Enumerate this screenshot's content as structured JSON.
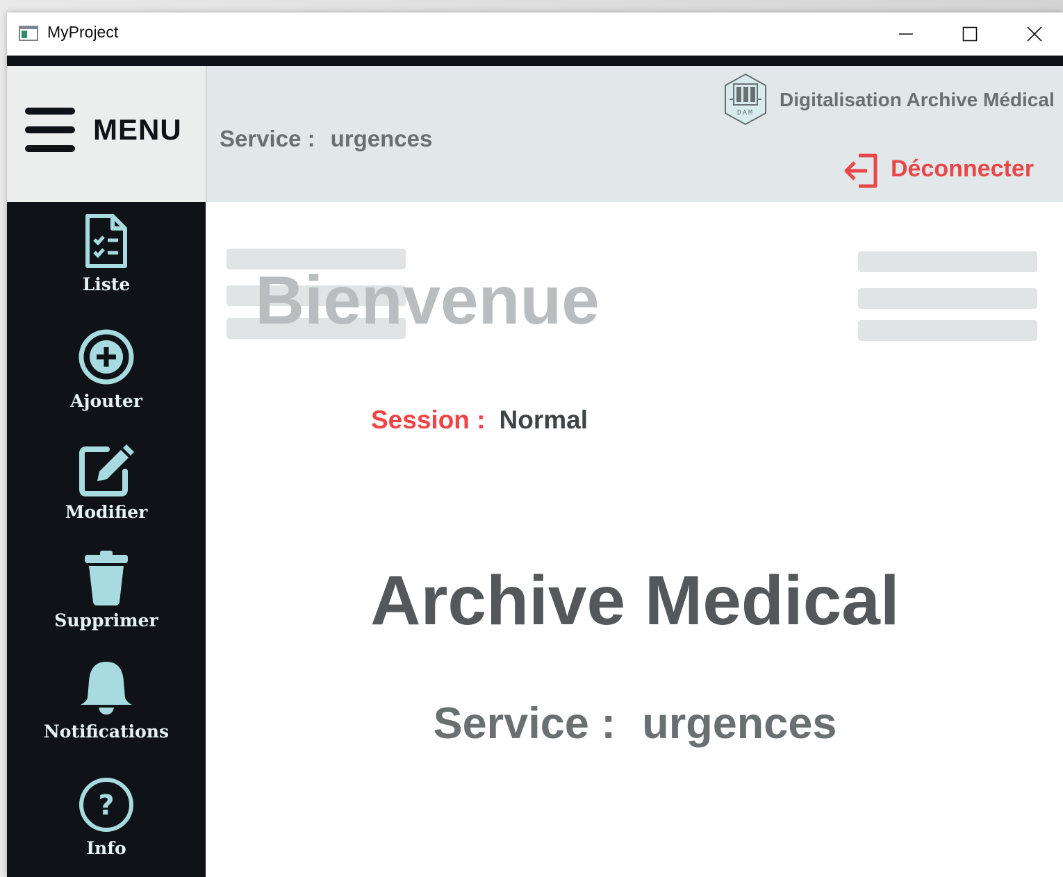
{
  "window": {
    "title": "MyProject",
    "controls": [
      "minimize-icon",
      "maximize-icon",
      "close-icon"
    ]
  },
  "menu": {
    "label": "MENU",
    "icon": "hamburger-icon"
  },
  "sidebar": {
    "items": [
      {
        "label": "Liste",
        "icon": "checklist-document-icon"
      },
      {
        "label": "Ajouter",
        "icon": "plus-circle-icon"
      },
      {
        "label": "Modifier",
        "icon": "edit-icon"
      },
      {
        "label": "Supprimer",
        "icon": "trash-icon"
      },
      {
        "label": "Notifications",
        "icon": "bell-icon"
      },
      {
        "label": "Info",
        "icon": "question-circle-icon"
      }
    ]
  },
  "header": {
    "service_label": "Service :",
    "service_value": "urgences",
    "brand_text": "Digitalisation Archive Médical",
    "brand_logo_text": "DAM",
    "logout_label": "Déconnecter",
    "logout_icon": "logout-arrow-icon"
  },
  "main": {
    "welcome": "Bienvenue",
    "session_label": "Session :",
    "session_value": "Normal",
    "title": "Archive Medical",
    "service_label": "Service :",
    "service_value": "urgences"
  },
  "colors": {
    "sidebar_bg": "#0f1318",
    "header_bg": "#e2e8e9",
    "icon_accent": "#a7dbdf",
    "logout_red": "#e8474a",
    "session_red": "#f04346",
    "welcome_gray": "#b9bdbf"
  }
}
